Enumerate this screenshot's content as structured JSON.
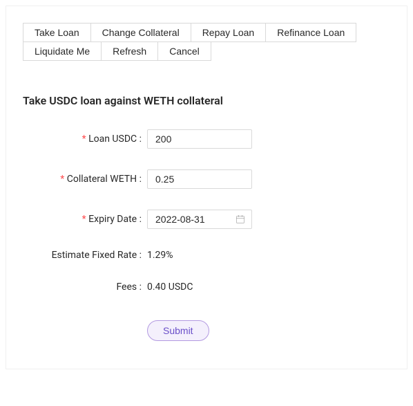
{
  "tabs": {
    "row1": [
      {
        "label": "Take Loan"
      },
      {
        "label": "Change Collateral"
      },
      {
        "label": "Repay Loan"
      },
      {
        "label": "Refinance Loan"
      }
    ],
    "row2": [
      {
        "label": "Liquidate Me"
      },
      {
        "label": "Refresh"
      },
      {
        "label": "Cancel"
      }
    ]
  },
  "heading": "Take USDC loan against WETH collateral",
  "form": {
    "loan_label": "Loan USDC",
    "loan_value": "200",
    "collateral_label": "Collateral WETH",
    "collateral_value": "0.25",
    "expiry_label": "Expiry Date",
    "expiry_value": "2022-08-31",
    "rate_label": "Estimate Fixed Rate",
    "rate_value": "1.29%",
    "fees_label": "Fees",
    "fees_value": "0.40 USDC",
    "submit_label": "Submit"
  }
}
